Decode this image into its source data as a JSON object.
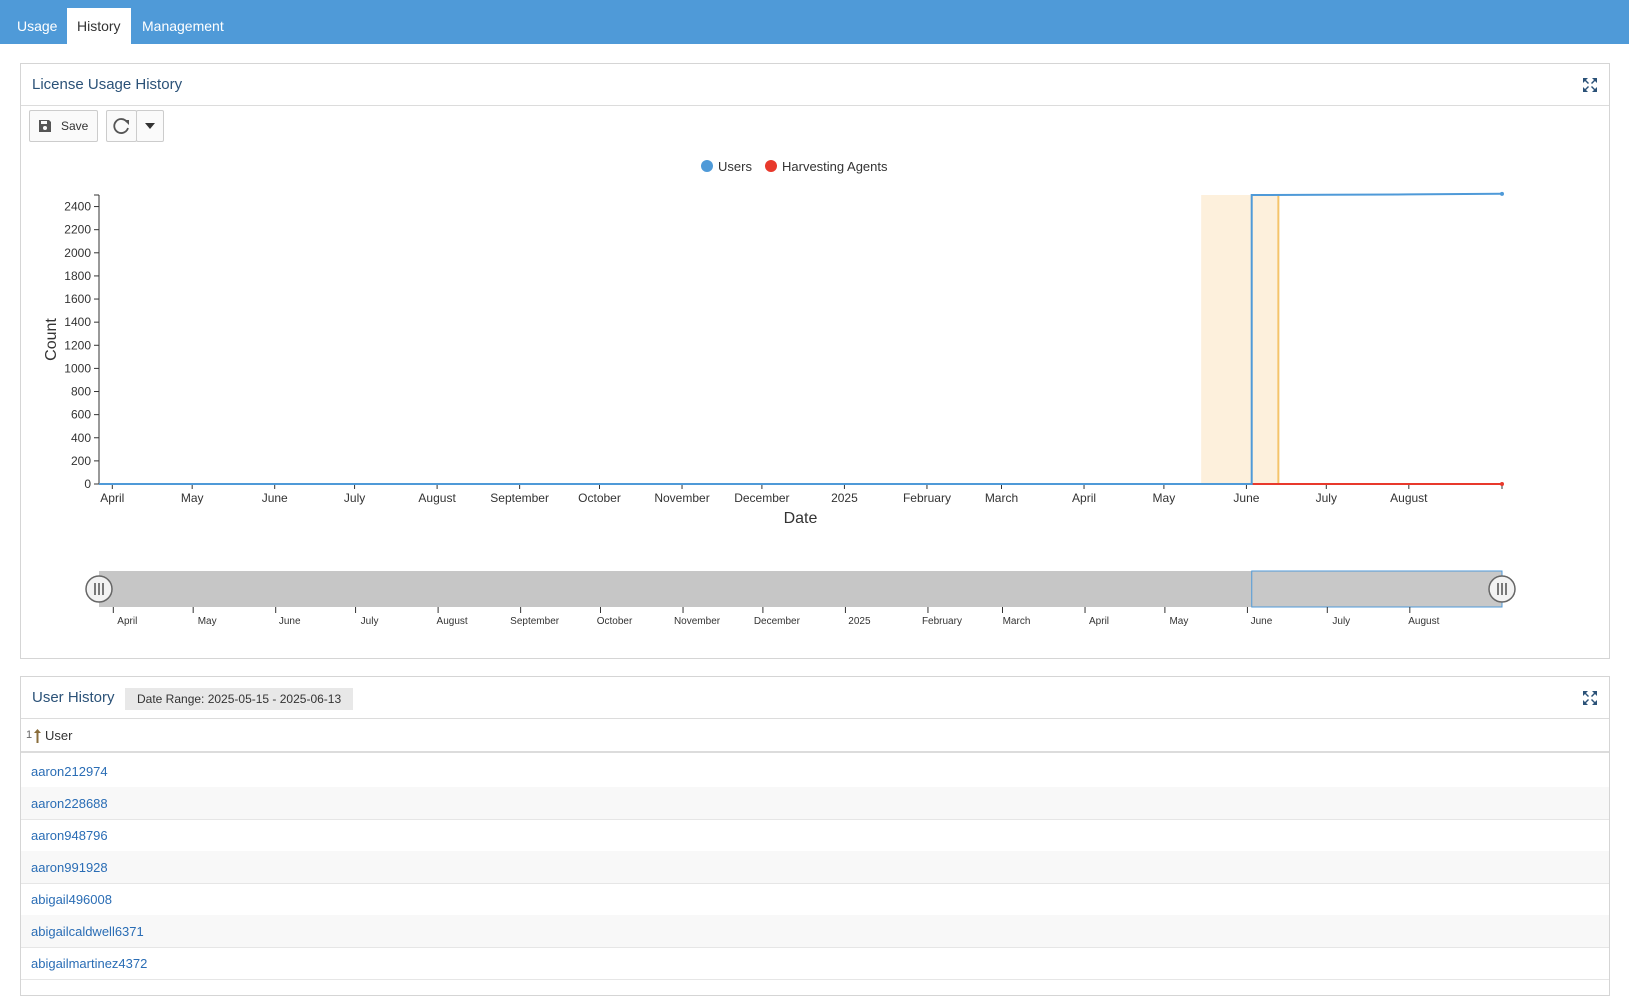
{
  "nav": {
    "tabs": [
      {
        "label": "Usage",
        "active": false
      },
      {
        "label": "History",
        "active": true
      },
      {
        "label": "Management",
        "active": false
      }
    ]
  },
  "license_panel": {
    "title": "License Usage History",
    "save_label": "Save",
    "icons": [
      "save-icon",
      "refresh-icon",
      "caret-down-icon",
      "expand-icon"
    ]
  },
  "chart_data": {
    "type": "line",
    "xlabel": "Date",
    "ylabel": "Count",
    "x_range": [
      "2024-03-27",
      "2025-09-05"
    ],
    "ylim": [
      0,
      2500
    ],
    "y_ticks": [
      0,
      200,
      400,
      600,
      800,
      1000,
      1200,
      1400,
      1600,
      1800,
      2000,
      2200,
      2400
    ],
    "x_ticks": [
      {
        "date": "2024-04-01",
        "label": "April"
      },
      {
        "date": "2024-05-01",
        "label": "May"
      },
      {
        "date": "2024-06-01",
        "label": "June"
      },
      {
        "date": "2024-07-01",
        "label": "July"
      },
      {
        "date": "2024-08-01",
        "label": "August"
      },
      {
        "date": "2024-09-01",
        "label": "September"
      },
      {
        "date": "2024-10-01",
        "label": "October"
      },
      {
        "date": "2024-11-01",
        "label": "November"
      },
      {
        "date": "2024-12-01",
        "label": "December"
      },
      {
        "date": "2025-01-01",
        "label": "2025"
      },
      {
        "date": "2025-02-01",
        "label": "February"
      },
      {
        "date": "2025-03-01",
        "label": "March"
      },
      {
        "date": "2025-04-01",
        "label": "April"
      },
      {
        "date": "2025-05-01",
        "label": "May"
      },
      {
        "date": "2025-06-01",
        "label": "June"
      },
      {
        "date": "2025-07-01",
        "label": "July"
      },
      {
        "date": "2025-08-01",
        "label": "August"
      }
    ],
    "legend": [
      "Users",
      "Harvesting Agents"
    ],
    "legend_position": "top-center",
    "grid": false,
    "highlight_range": [
      "2025-05-15",
      "2025-06-13"
    ],
    "series": [
      {
        "name": "Users",
        "color": "#4f9ad8",
        "points": [
          [
            "2024-03-27",
            0
          ],
          [
            "2025-06-03",
            0
          ],
          [
            "2025-06-03",
            2500
          ],
          [
            "2025-07-01",
            2502
          ],
          [
            "2025-08-01",
            2505
          ],
          [
            "2025-09-05",
            2510
          ]
        ]
      },
      {
        "name": "Harvesting Agents",
        "color": "#e8392c",
        "points": [
          [
            "2024-03-27",
            0
          ],
          [
            "2025-09-05",
            0
          ]
        ]
      }
    ],
    "navigator": {
      "selected_range": [
        "2025-06-03",
        "2025-09-05"
      ]
    }
  },
  "user_panel": {
    "title": "User History",
    "badge": "Date Range: 2025-05-15 - 2025-06-13",
    "sort_indicator": "1",
    "column_header": "User",
    "rows": [
      "aaron212974",
      "aaron228688",
      "aaron948796",
      "aaron991928",
      "abigail496008",
      "abigailcaldwell6371",
      "abigailmartinez4372"
    ]
  },
  "colors": {
    "nav": "#4f9ad8",
    "users": "#4f9ad8",
    "agents": "#e8392c",
    "highlight": "#fdf0dc",
    "link": "#2a6db5"
  }
}
